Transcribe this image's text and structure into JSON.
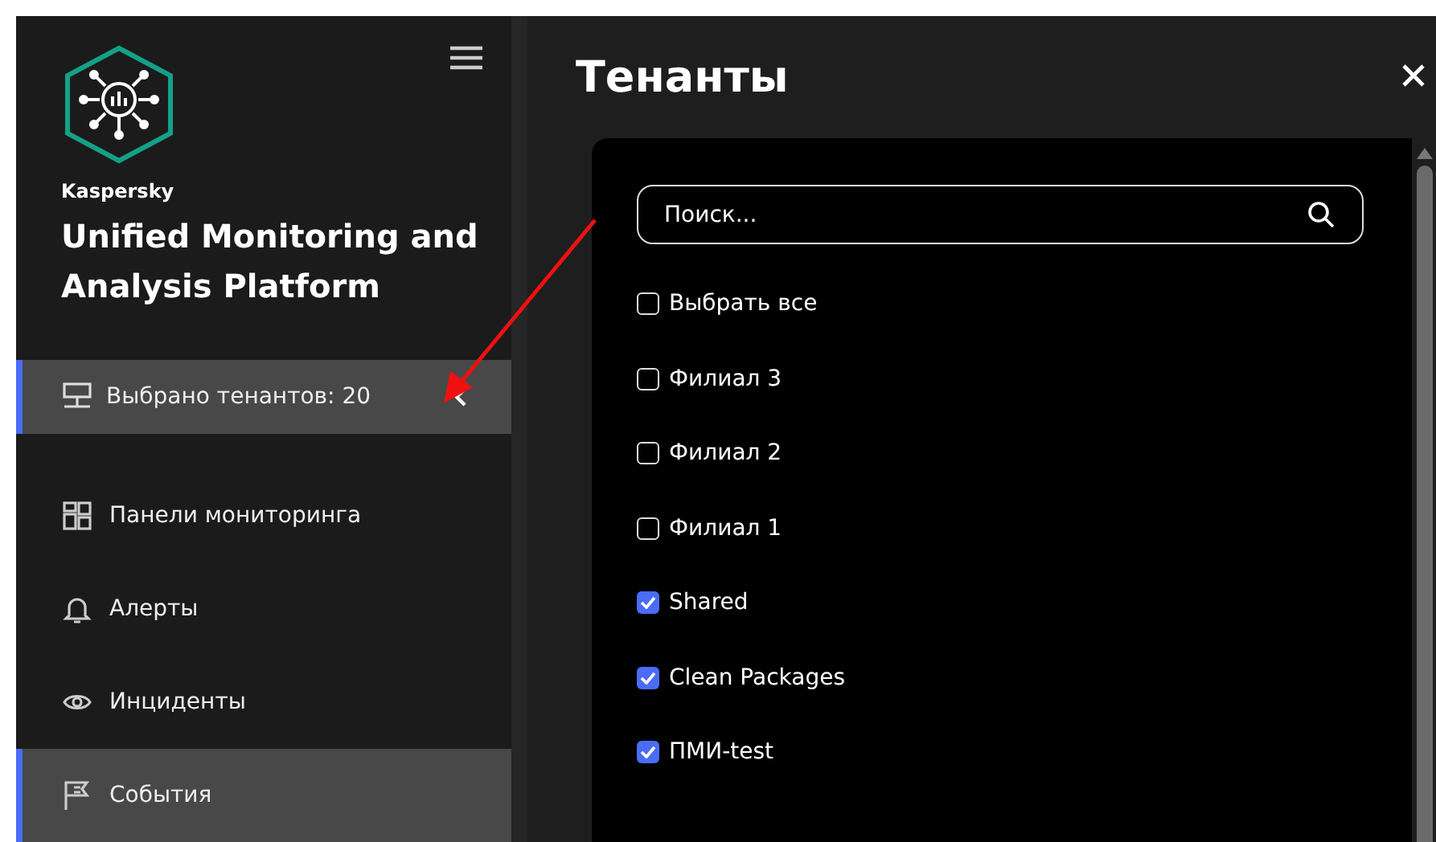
{
  "sidebar": {
    "brand": "Kaspersky",
    "product": "Unified Monitoring and Analysis Platform",
    "tenant_selector": {
      "label": "Выбрано тенантов: 20",
      "expanded": true
    },
    "items": [
      {
        "label": "Панели мониторинга",
        "kind": "dashboard",
        "selected": false
      },
      {
        "label": "Алерты",
        "kind": "bell",
        "selected": false
      },
      {
        "label": "Инциденты",
        "kind": "eye",
        "selected": false
      },
      {
        "label": "События",
        "kind": "flag",
        "selected": true
      }
    ]
  },
  "panel": {
    "title": "Тенанты",
    "search": {
      "placeholder": "Поиск..."
    },
    "options": [
      {
        "label": "Выбрать все",
        "checked": false
      },
      {
        "label": "Филиал 3",
        "checked": false
      },
      {
        "label": "Филиал 2",
        "checked": false
      },
      {
        "label": "Филиал 1",
        "checked": false
      },
      {
        "label": "Shared",
        "checked": true
      },
      {
        "label": "Clean Packages",
        "checked": true
      },
      {
        "label": "ПМИ-test",
        "checked": true
      }
    ]
  }
}
